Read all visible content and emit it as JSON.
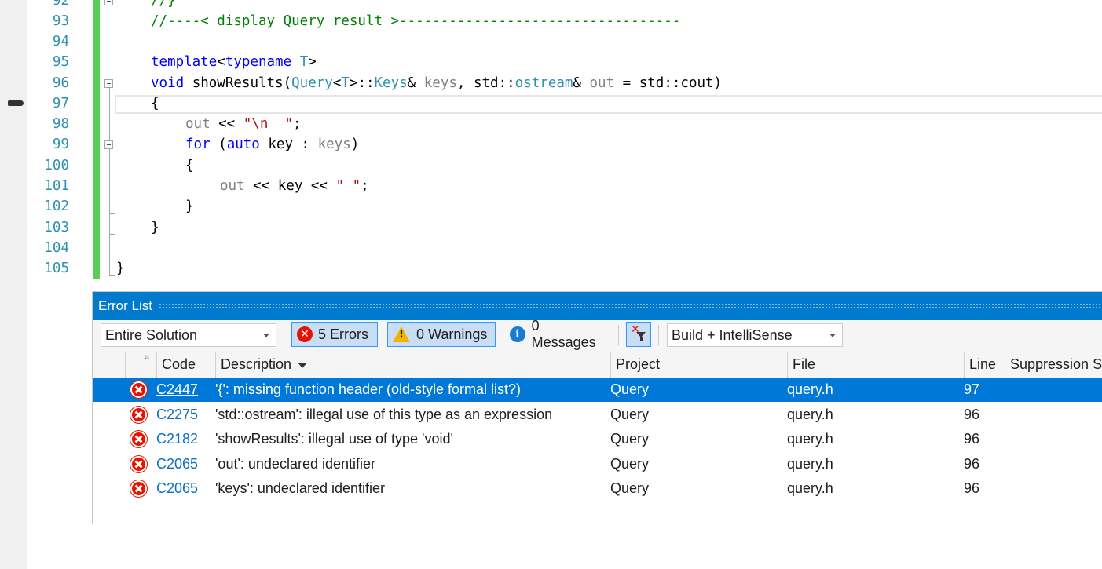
{
  "editor": {
    "line_numbers": [
      "92",
      "93",
      "94",
      "95",
      "96",
      "97",
      "98",
      "99",
      "100",
      "101",
      "102",
      "103",
      "104",
      "105"
    ],
    "lines": {
      "l92": "//}",
      "l93": "//----< display Query result >----------------------------------",
      "l95_kw": "template",
      "l95_rest1": "<",
      "l95_kw2": "typename",
      "l95_ty": "T",
      "l95_rest2": ">",
      "l96_kw": "void",
      "l96_fn": " showResults(",
      "l96_ty1": "Query",
      "l96_p1": "<",
      "l96_ty2": "T",
      "l96_p2": ">::",
      "l96_ty3": "Keys",
      "l96_p3": "& ",
      "l96_pr1": "keys",
      "l96_p4": ", std::",
      "l96_ty4": "ostream",
      "l96_p5": "& ",
      "l96_pr2": "out",
      "l96_p6": " = std::cout)",
      "l97": "{",
      "l98_pr": "out",
      "l98_op": " << ",
      "l98_st": "\"\\n  \"",
      "l98_end": ";",
      "l99_kw": "for",
      "l99_p1": " (",
      "l99_kw2": "auto",
      "l99_p2": " key : ",
      "l99_pr": "keys",
      "l99_p3": ")",
      "l100": "{",
      "l101_pr": "out",
      "l101_p1": " << key << ",
      "l101_st": "\" \"",
      "l101_end": ";",
      "l102": "}",
      "l103": "}",
      "l105": "}"
    }
  },
  "error_list": {
    "title": "Error List",
    "scope_select": "Entire Solution",
    "errors_button": "5 Errors",
    "warnings_button": "0 Warnings",
    "messages_button": "0 Messages",
    "source_select": "Build + IntelliSense",
    "columns": {
      "code": "Code",
      "description": "Description",
      "project": "Project",
      "file": "File",
      "line": "Line",
      "suppression": "Suppression St"
    },
    "rows": [
      {
        "code": "C2447",
        "description": "'{': missing function header (old-style formal list?)",
        "project": "Query",
        "file": "query.h",
        "line": "97"
      },
      {
        "code": "C2275",
        "description": "'std::ostream': illegal use of this type as an expression",
        "project": "Query",
        "file": "query.h",
        "line": "96"
      },
      {
        "code": "C2182",
        "description": "'showResults': illegal use of type 'void'",
        "project": "Query",
        "file": "query.h",
        "line": "96"
      },
      {
        "code": "C2065",
        "description": "'out': undeclared identifier",
        "project": "Query",
        "file": "query.h",
        "line": "96"
      },
      {
        "code": "C2065",
        "description": "'keys': undeclared identifier",
        "project": "Query",
        "file": "query.h",
        "line": "96"
      }
    ],
    "selected_row": 0
  },
  "colors": {
    "accent": "#007acc",
    "selection": "#0078d7",
    "error": "#e51400",
    "change_bar": "#57cc57",
    "line_number": "#2b91af"
  }
}
